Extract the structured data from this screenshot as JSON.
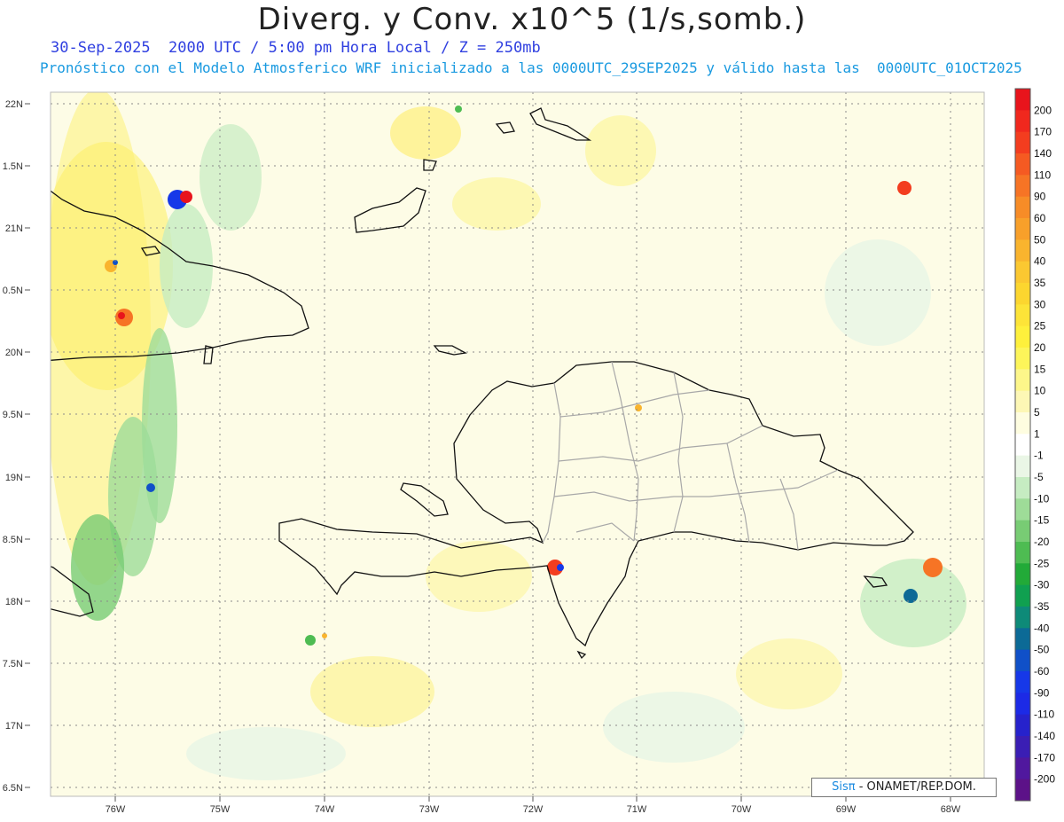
{
  "header": {
    "title": "Diverg. y Conv. x10^5 (1/s,somb.)",
    "subtitle_line1": "30-Sep-2025  2000 UTC / 5:00 pm Hora Local / Z = 250mb",
    "subtitle_line2": "Pronóstico con el Modelo Atmosferico WRF inicializado a las 0000UTC_29SEP2025 y válido hasta las  0000UTC_01OCT2025"
  },
  "map": {
    "lat_labels": [
      "22N",
      "1.5N",
      "21N",
      "0.5N",
      "20N",
      "9.5N",
      "19N",
      "8.5N",
      "18N",
      "7.5N",
      "17N",
      "6.5N"
    ],
    "lon_labels": [
      "76W",
      "75W",
      "74W",
      "73W",
      "72W",
      "71W",
      "70W",
      "69W",
      "68W"
    ],
    "colors": {
      "background_field": "#fdfce0",
      "coastline": "#111111",
      "province_border": "#a8a8a8",
      "gridline": "#8a8a8a"
    }
  },
  "colorbar": {
    "labels": [
      "200",
      "170",
      "140",
      "110",
      "90",
      "60",
      "50",
      "40",
      "35",
      "30",
      "25",
      "20",
      "15",
      "10",
      "5",
      "1",
      "-1",
      "-5",
      "-10",
      "-15",
      "-20",
      "-25",
      "-30",
      "-35",
      "-40",
      "-50",
      "-60",
      "-90",
      "-110",
      "-140",
      "-170",
      "-200"
    ],
    "colors": [
      "#e8141c",
      "#f0281e",
      "#f33d1f",
      "#f55a22",
      "#f67425",
      "#f78c27",
      "#f8a02a",
      "#f9b42e",
      "#fbc831",
      "#fcd62f",
      "#fde438",
      "#fef03c",
      "#fdf55a",
      "#fdf68a",
      "#fdf7b5",
      "#fefde0",
      "#ffffff",
      "#eaf6e6",
      "#c6ecc2",
      "#9edc98",
      "#78cc74",
      "#4ebc52",
      "#22aa38",
      "#10a050",
      "#0e8a78",
      "#0c6a96",
      "#1050c8",
      "#1638e8",
      "#1c2ae6",
      "#2622cc",
      "#3a1eb4",
      "#50189e",
      "#5c1288"
    ]
  },
  "footer": {
    "credit_logo": "Sisπ",
    "credit_text": " - ONAMET/REP.DOM."
  }
}
